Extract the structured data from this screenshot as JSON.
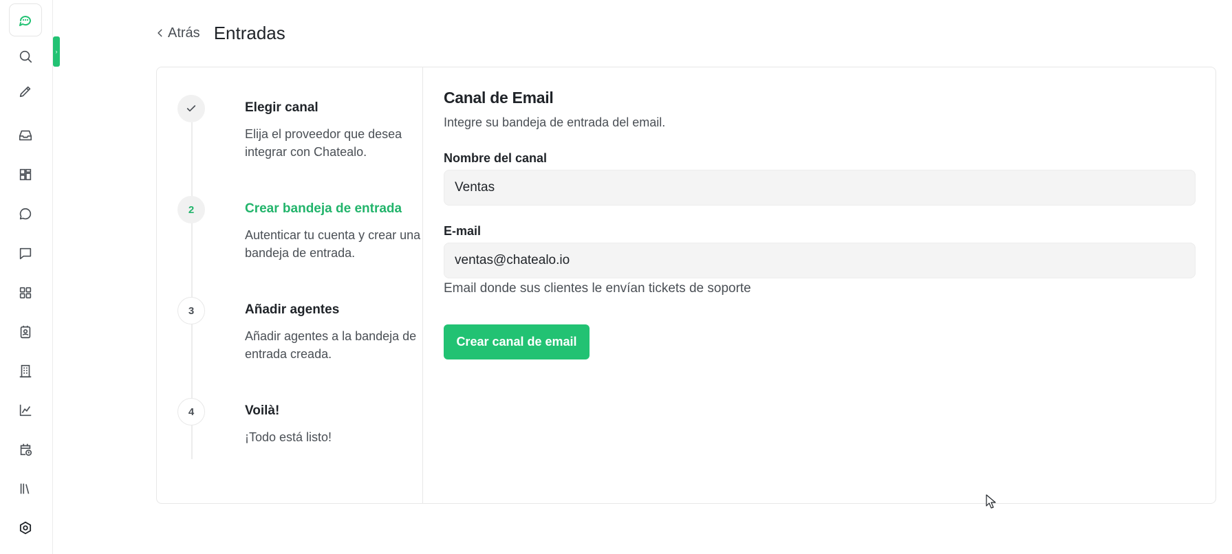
{
  "header": {
    "back_label": "Atrás",
    "title": "Entradas"
  },
  "sidebar": {
    "toggle_glyph": "›",
    "icons": [
      "search-icon",
      "compose-icon",
      "inbox-icon",
      "dashboard-icon",
      "conversation-icon",
      "message-icon",
      "apps-icon",
      "contacts-icon",
      "building-icon",
      "reports-icon",
      "calendar-clock-icon",
      "library-icon",
      "settings-icon"
    ]
  },
  "steps": [
    {
      "badge": "",
      "title": "Elegir canal",
      "description": "Elija el proveedor que desea integrar con Chatealo.",
      "state": "done"
    },
    {
      "badge": "2",
      "title": "Crear bandeja de entrada",
      "description": "Autenticar tu cuenta y crear una bandeja de entrada.",
      "state": "active"
    },
    {
      "badge": "3",
      "title": "Añadir agentes",
      "description": "Añadir agentes a la bandeja de entrada creada.",
      "state": "pending"
    },
    {
      "badge": "4",
      "title": "Voilà!",
      "description": "¡Todo está listo!",
      "state": "pending"
    }
  ],
  "form": {
    "title": "Canal de Email",
    "subtitle": "Integre su bandeja de entrada del email.",
    "channel_name_label": "Nombre del canal",
    "channel_name_value": "Ventas",
    "email_label": "E-mail",
    "email_value": "ventas@chatealo.io",
    "email_help": "Email donde sus clientes le envían tickets de soporte",
    "submit_label": "Crear canal de email"
  },
  "colors": {
    "accent": "#22c273",
    "accent_text": "#22b46b",
    "text": "#1f2328",
    "muted": "#4a4f55",
    "input_bg": "#f4f4f4"
  }
}
